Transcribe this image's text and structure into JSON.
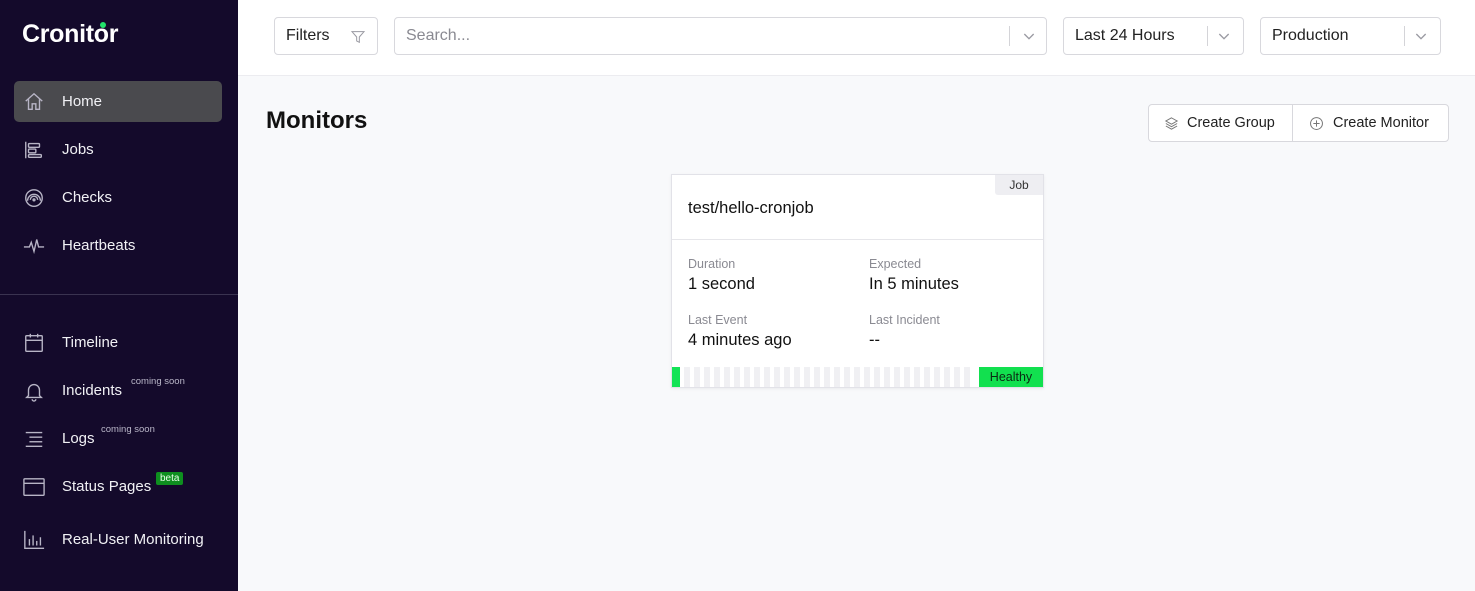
{
  "app": {
    "logo_text": "Cronitor"
  },
  "sidebar": {
    "primary": [
      {
        "label": "Home",
        "icon": "home-icon",
        "active": true
      },
      {
        "label": "Jobs",
        "icon": "jobs-icon"
      },
      {
        "label": "Checks",
        "icon": "checks-icon"
      },
      {
        "label": "Heartbeats",
        "icon": "heartbeat-icon"
      }
    ],
    "secondary": [
      {
        "label": "Timeline",
        "icon": "calendar-icon"
      },
      {
        "label": "Incidents",
        "icon": "bell-icon",
        "tag": "coming soon"
      },
      {
        "label": "Logs",
        "icon": "logs-icon",
        "tag": "coming soon"
      },
      {
        "label": "Status Pages",
        "icon": "window-icon",
        "badge": "beta"
      },
      {
        "label": "Real-User Monitoring",
        "icon": "bar-chart-icon"
      }
    ]
  },
  "topbar": {
    "filters_label": "Filters",
    "search_placeholder": "Search...",
    "time_range": "Last 24 Hours",
    "environment": "Production"
  },
  "main": {
    "title": "Monitors",
    "create_group_label": "Create Group",
    "create_monitor_label": "Create Monitor"
  },
  "monitor_card": {
    "type": "Job",
    "name": "test/hello-cronjob",
    "duration_label": "Duration",
    "duration_value": "1 second",
    "expected_label": "Expected",
    "expected_value": "In 5 minutes",
    "last_event_label": "Last Event",
    "last_event_value": "4 minutes ago",
    "last_incident_label": "Last Incident",
    "last_incident_value": "--",
    "status": "Healthy",
    "status_color": "#12e04f"
  },
  "colors": {
    "sidebar_bg": "#140a2b",
    "active_item_bg": "#4a4a4e",
    "beta_badge": "#0e8f1f",
    "healthy": "#12e04f"
  }
}
